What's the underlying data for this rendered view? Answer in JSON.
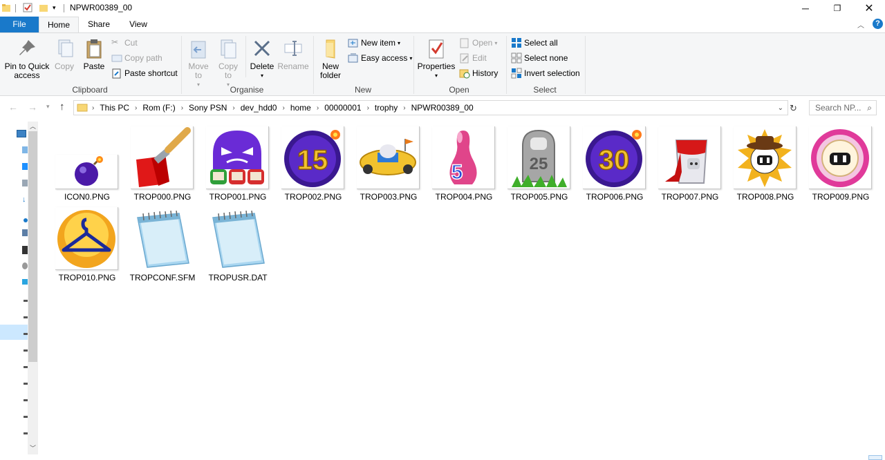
{
  "window": {
    "title": "NPWR00389_00"
  },
  "tabs": {
    "file": "File",
    "home": "Home",
    "share": "Share",
    "view": "View"
  },
  "ribbon": {
    "clipboard": {
      "label": "Clipboard",
      "pin": "Pin to Quick access",
      "copy": "Copy",
      "paste": "Paste",
      "cut": "Cut",
      "copy_path": "Copy path",
      "paste_shortcut": "Paste shortcut"
    },
    "organise": {
      "label": "Organise",
      "move_to": "Move to",
      "copy_to": "Copy to",
      "delete": "Delete",
      "rename": "Rename"
    },
    "new": {
      "label": "New",
      "new_folder": "New folder",
      "new_item": "New item",
      "easy_access": "Easy access"
    },
    "open": {
      "label": "Open",
      "properties": "Properties",
      "open": "Open",
      "edit": "Edit",
      "history": "History"
    },
    "select": {
      "label": "Select",
      "select_all": "Select all",
      "select_none": "Select none",
      "invert": "Invert selection"
    }
  },
  "address": {
    "crumbs": [
      "This PC",
      "Rom (F:)",
      "Sony PSN",
      "dev_hdd0",
      "home",
      "00000001",
      "trophy",
      "NPWR00389_00"
    ],
    "search_placeholder": "Search NP..."
  },
  "files": [
    {
      "name": "ICON0.PNG",
      "icon": "bomb-icon"
    },
    {
      "name": "TROP000.PNG",
      "icon": "paintbrush-icon"
    },
    {
      "name": "TROP001.PNG",
      "icon": "purple-monster-icon"
    },
    {
      "name": "TROP002.PNG",
      "icon": "number-15-medal-icon"
    },
    {
      "name": "TROP003.PNG",
      "icon": "kart-icon"
    },
    {
      "name": "TROP004.PNG",
      "icon": "bowling-pin-5-icon"
    },
    {
      "name": "TROP005.PNG",
      "icon": "tombstone-25-icon"
    },
    {
      "name": "TROP006.PNG",
      "icon": "number-30-medal-icon"
    },
    {
      "name": "TROP007.PNG",
      "icon": "paint-bucket-icon"
    },
    {
      "name": "TROP008.PNG",
      "icon": "cowboy-bomberman-icon"
    },
    {
      "name": "TROP009.PNG",
      "icon": "pink-bomberman-icon"
    },
    {
      "name": "TROP010.PNG",
      "icon": "hanger-icon"
    },
    {
      "name": "TROPCONF.SFM",
      "icon": "notepad-icon"
    },
    {
      "name": "TROPUSR.DAT",
      "icon": "notepad-icon"
    }
  ],
  "colors": {
    "file_tab": "#1979ca",
    "accent": "#0078d7"
  }
}
